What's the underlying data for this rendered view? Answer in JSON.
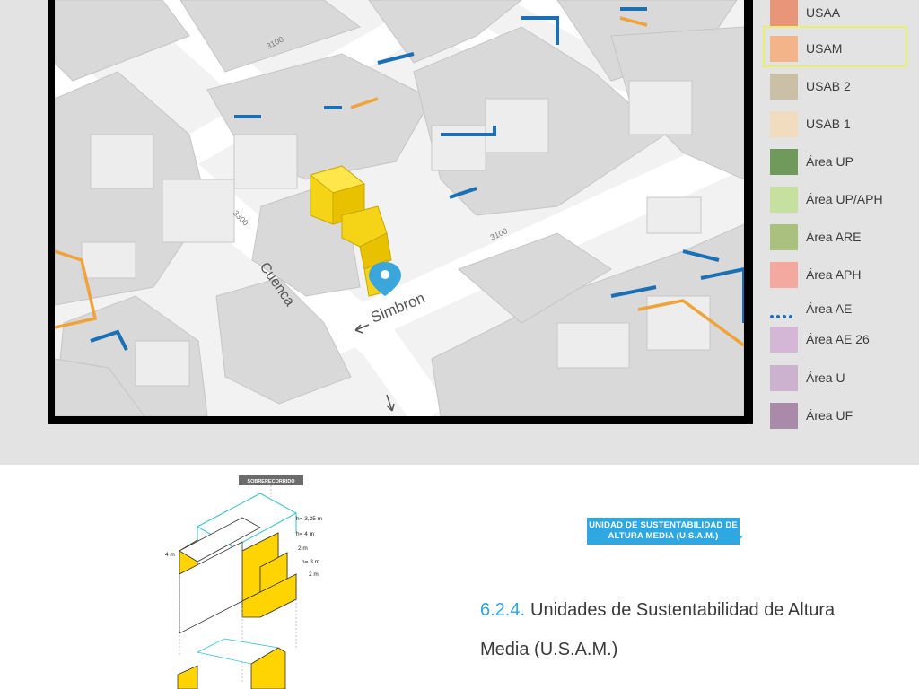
{
  "map": {
    "streets": {
      "cuenca": "Cuenca",
      "simbron": "Simbron",
      "num_3100_top": "3100",
      "num_3300": "3300",
      "num_3100_mid": "3100"
    },
    "marker": "location-pin-icon"
  },
  "legend": {
    "items": [
      {
        "label": "USAA",
        "color": "#e8957a"
      },
      {
        "label": "USAM",
        "color": "#f4b48a",
        "highlighted": true
      },
      {
        "label": "USAB 2",
        "color": "#c9c0a6"
      },
      {
        "label": "USAB 1",
        "color": "#f1dcc0"
      },
      {
        "label": "Área UP",
        "color": "#6f9a5c"
      },
      {
        "label": "Área UP/APH",
        "color": "#c6e0a0"
      },
      {
        "label": "Área ARE",
        "color": "#a9c07f"
      },
      {
        "label": "Área APH",
        "color": "#f3a8a0"
      },
      {
        "label": "Área AE",
        "color": "#1a6fb5",
        "style": "dotted-line"
      },
      {
        "label": "Área AE 26",
        "color": "#d4b6d6"
      },
      {
        "label": "Área U",
        "color": "#cdb2cf"
      },
      {
        "label": "Área UF",
        "color": "#a98aa8"
      }
    ]
  },
  "diagram": {
    "tag": "SOBRERECORRIDO",
    "labels": {
      "h1": "h= 3,25 m",
      "h2": "h= 4 m",
      "d1": "2 m",
      "h3": "h= 3 m",
      "d2": "2 m",
      "depth": "4 m"
    }
  },
  "badge": {
    "line1": "UNIDAD DE SUSTENTABILIDAD DE",
    "line2": "ALTURA MEDIA (U.S.A.M.)"
  },
  "section": {
    "number": "6.2.4.",
    "title_line1": "Unidades de Sustentabilidad de Altura",
    "title_line2": "Media (U.S.A.M.)"
  }
}
